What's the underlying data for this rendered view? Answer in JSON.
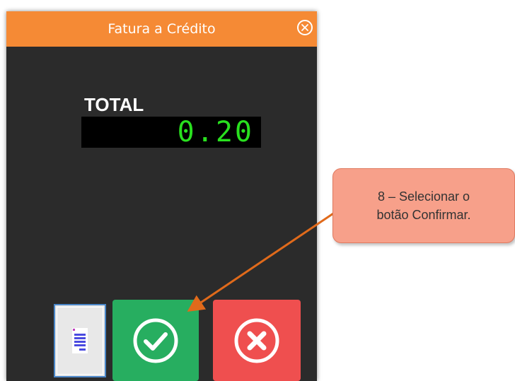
{
  "window": {
    "title": "Fatura a Crédito",
    "close_icon": "close-circle-icon"
  },
  "total": {
    "label": "TOTAL",
    "value": "0.20"
  },
  "buttons": {
    "document_icon": "document-icon",
    "confirm_icon": "check-circle-icon",
    "cancel_icon": "x-circle-icon"
  },
  "callout": {
    "line1": "8 – Selecionar o",
    "line2": "botão Confirmar."
  },
  "colors": {
    "titlebar": "#f58a35",
    "background": "#2b2b2b",
    "display_text": "#29e01f",
    "confirm": "#27ae60",
    "cancel": "#ef4f4f",
    "callout": "#f7a08a",
    "arrow": "#e06a1b"
  }
}
